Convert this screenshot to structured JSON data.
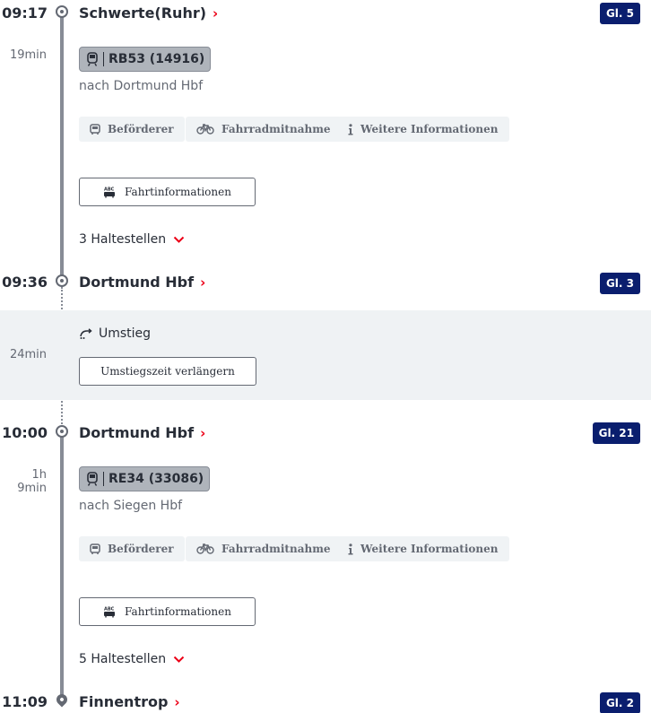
{
  "colors": {
    "accent": "#ec0016",
    "track_badge": "#0a1e6e",
    "timeline": "#878c96",
    "train_badge": "#afb4bb",
    "transfer_bg": "#eff2f4"
  },
  "leg1": {
    "departure": {
      "time": "09:17",
      "station": "Schwerte(Ruhr)",
      "track": "Gl. 5"
    },
    "duration": "19min",
    "train": {
      "icon": "train-icon",
      "name": "RB53 (14916)"
    },
    "direction": "nach Dortmund Hbf",
    "chips": {
      "carrier": "Beförderer",
      "bike": "Fahrradmitnahme",
      "info": "Weitere Informationen"
    },
    "trip_info": "Fahrtinformationen",
    "stops": "3 Haltestellen",
    "arrival": {
      "time": "09:36",
      "station": "Dortmund Hbf",
      "track": "Gl. 3"
    }
  },
  "transfer": {
    "duration": "24min",
    "label": "Umstieg",
    "extend": "Umstiegszeit verlängern"
  },
  "leg2": {
    "departure": {
      "time": "10:00",
      "station": "Dortmund Hbf",
      "track": "Gl. 21"
    },
    "duration": "1h 9min",
    "train": {
      "icon": "train-icon",
      "name": "RE34 (33086)"
    },
    "direction": "nach Siegen Hbf",
    "chips": {
      "carrier": "Beförderer",
      "bike": "Fahrradmitnahme",
      "info": "Weitere Informationen"
    },
    "trip_info": "Fahrtinformationen",
    "stops": "5 Haltestellen",
    "arrival": {
      "time": "11:09",
      "station": "Finnentrop",
      "track": "Gl. 2"
    }
  }
}
